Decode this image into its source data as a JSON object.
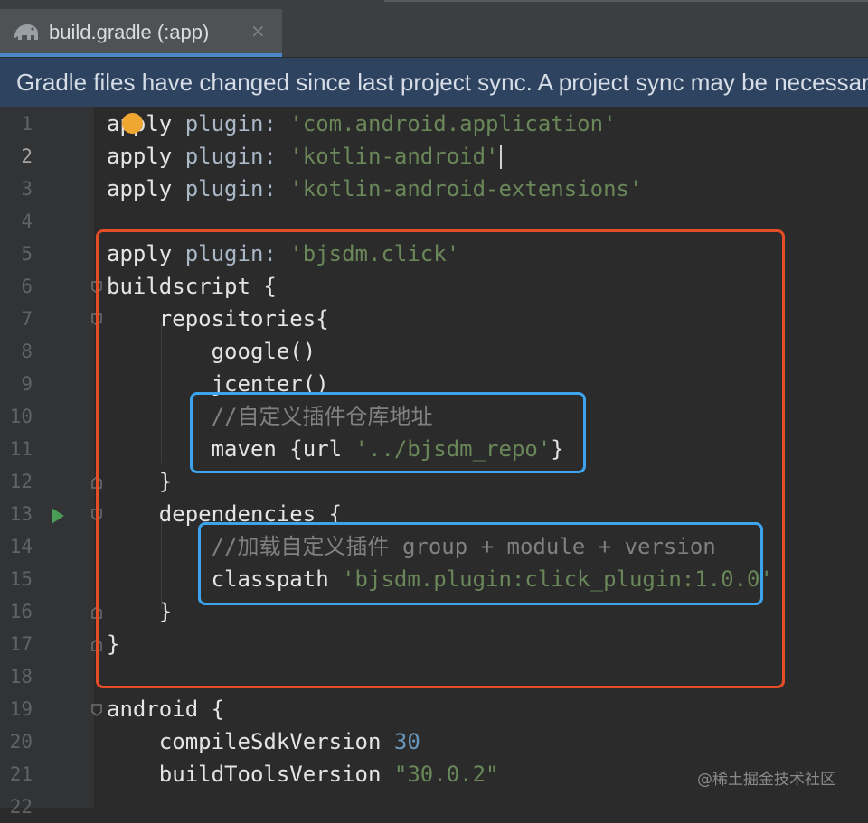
{
  "tab": {
    "title": "build.gradle (:app)",
    "close": "×",
    "icon": "gradle-elephant-icon"
  },
  "banner": {
    "message": "Gradle files have changed since last project sync. A project sync may be necessary for the IDE to work properly."
  },
  "editor": {
    "current_line": 2,
    "line_numbers": [
      "1",
      "2",
      "3",
      "4",
      "5",
      "6",
      "7",
      "8",
      "9",
      "10",
      "11",
      "12",
      "13",
      "14",
      "15",
      "16",
      "17",
      "18",
      "19",
      "20",
      "21",
      "22"
    ],
    "lines": [
      [
        {
          "t": "kw",
          "v": "apply "
        },
        {
          "t": "id",
          "v": "plugin: "
        },
        {
          "t": "str",
          "v": "'com.android.application'"
        }
      ],
      [
        {
          "t": "kw",
          "v": "apply "
        },
        {
          "t": "id",
          "v": "plugin: "
        },
        {
          "t": "str",
          "v": "'kotlin-android'"
        }
      ],
      [
        {
          "t": "kw",
          "v": "apply "
        },
        {
          "t": "id",
          "v": "plugin: "
        },
        {
          "t": "str",
          "v": "'kotlin-android-extensions'"
        }
      ],
      [],
      [
        {
          "t": "kw",
          "v": "apply "
        },
        {
          "t": "id",
          "v": "plugin: "
        },
        {
          "t": "str",
          "v": "'bjsdm.click'"
        }
      ],
      [
        {
          "t": "plain",
          "v": "buildscript {"
        }
      ],
      [
        {
          "t": "plain",
          "v": "    repositories{"
        }
      ],
      [
        {
          "t": "plain",
          "v": "        google()"
        }
      ],
      [
        {
          "t": "plain",
          "v": "        jcenter()"
        }
      ],
      [
        {
          "t": "cmt",
          "v": "        //自定义插件仓库地址"
        }
      ],
      [
        {
          "t": "plain",
          "v": "        maven {url "
        },
        {
          "t": "str",
          "v": "'../bjsdm_repo'"
        },
        {
          "t": "plain",
          "v": "}"
        }
      ],
      [
        {
          "t": "plain",
          "v": "    }"
        }
      ],
      [
        {
          "t": "plain",
          "v": "    dependencies {"
        }
      ],
      [
        {
          "t": "cmt",
          "v": "        //加载自定义插件 group + module + version"
        }
      ],
      [
        {
          "t": "plain",
          "v": "        classpath "
        },
        {
          "t": "str",
          "v": "'bjsdm.plugin:click_plugin:1.0.0'"
        }
      ],
      [
        {
          "t": "plain",
          "v": "    }"
        }
      ],
      [
        {
          "t": "plain",
          "v": "}"
        }
      ],
      [],
      [
        {
          "t": "plain",
          "v": "android {"
        }
      ],
      [
        {
          "t": "plain",
          "v": "    compileSdkVersion "
        },
        {
          "t": "num",
          "v": "30"
        }
      ],
      [
        {
          "t": "plain",
          "v": "    buildToolsVersion "
        },
        {
          "t": "str",
          "v": "\"30.0.2\""
        }
      ],
      []
    ]
  },
  "watermark": "@稀土掘金技术社区",
  "colors": {
    "background": "#2b2b2b",
    "gutter": "#313335",
    "banner": "#2e4360",
    "string": "#6a8759",
    "number": "#6897bb",
    "comment": "#808080",
    "highlight_red": "#e44d26",
    "highlight_blue": "#3ca4ec"
  }
}
